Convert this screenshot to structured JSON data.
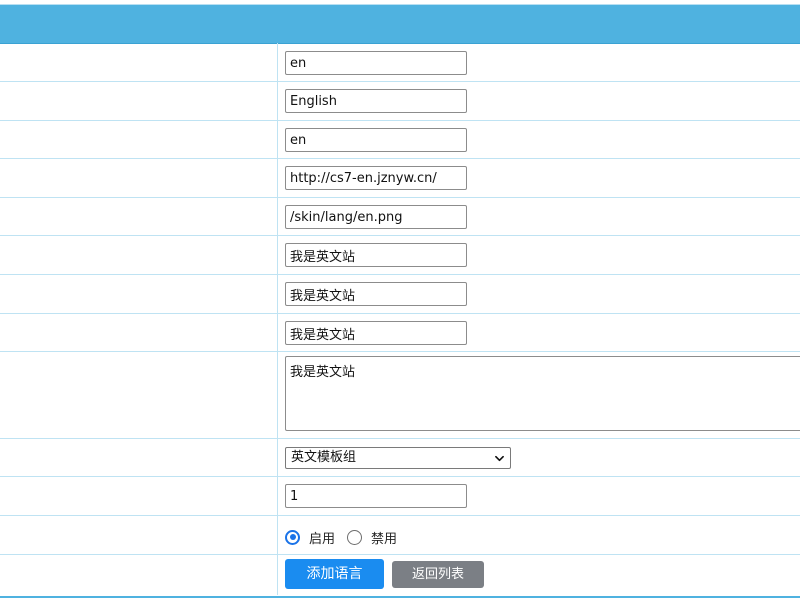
{
  "form": {
    "fields": [
      {
        "value": "en"
      },
      {
        "value": "English"
      },
      {
        "value": "en"
      },
      {
        "value": "http://cs7-en.jznyw.cn/"
      },
      {
        "value": "/skin/lang/en.png"
      },
      {
        "value": "我是英文站"
      },
      {
        "value": "我是英文站"
      },
      {
        "value": "我是英文站"
      }
    ],
    "textarea": {
      "value": "我是英文站"
    },
    "template_select": {
      "selected": "英文模板组"
    },
    "sort_order": {
      "value": "1"
    },
    "status": {
      "enabled_label": "启用",
      "disabled_label": "禁用",
      "selected": "enabled"
    },
    "buttons": {
      "submit_label": "添加语言",
      "back_label": "返回列表"
    }
  },
  "colors": {
    "header": "#4fb2e0",
    "primary_button": "#1a8cf0",
    "secondary_button": "#7b7f85",
    "row_border": "#bfe3f3"
  }
}
